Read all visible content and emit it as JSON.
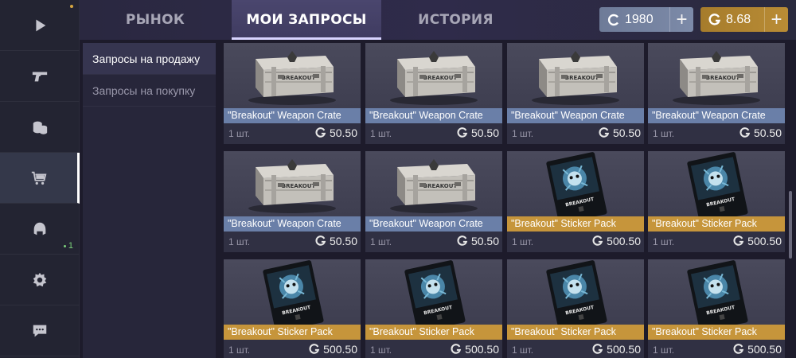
{
  "rail": {
    "badge_count": "1"
  },
  "tabs": [
    {
      "label": "РЫНОК"
    },
    {
      "label": "МОИ ЗАПРОСЫ"
    },
    {
      "label": "ИСТОРИЯ"
    }
  ],
  "currency": {
    "silver": "1980",
    "gold": "8.68",
    "plus": "+"
  },
  "subnav": [
    {
      "label": "Запросы на продажу"
    },
    {
      "label": "Запросы на покупку"
    }
  ],
  "items": [
    {
      "name": "\"Breakout\" Weapon Crate",
      "qty": "1 шт.",
      "price": "50.50",
      "kind": "crate"
    },
    {
      "name": "\"Breakout\" Weapon Crate",
      "qty": "1 шт.",
      "price": "50.50",
      "kind": "crate"
    },
    {
      "name": "\"Breakout\" Weapon Crate",
      "qty": "1 шт.",
      "price": "50.50",
      "kind": "crate"
    },
    {
      "name": "\"Breakout\" Weapon Crate",
      "qty": "1 шт.",
      "price": "50.50",
      "kind": "crate"
    },
    {
      "name": "\"Breakout\" Weapon Crate",
      "qty": "1 шт.",
      "price": "50.50",
      "kind": "crate"
    },
    {
      "name": "\"Breakout\" Weapon Crate",
      "qty": "1 шт.",
      "price": "50.50",
      "kind": "crate"
    },
    {
      "name": "\"Breakout\" Sticker Pack",
      "qty": "1 шт.",
      "price": "500.50",
      "kind": "sticker"
    },
    {
      "name": "\"Breakout\" Sticker Pack",
      "qty": "1 шт.",
      "price": "500.50",
      "kind": "sticker"
    },
    {
      "name": "\"Breakout\" Sticker Pack",
      "qty": "1 шт.",
      "price": "500.50",
      "kind": "sticker"
    },
    {
      "name": "\"Breakout\" Sticker Pack",
      "qty": "1 шт.",
      "price": "500.50",
      "kind": "sticker"
    },
    {
      "name": "\"Breakout\" Sticker Pack",
      "qty": "1 шт.",
      "price": "500.50",
      "kind": "sticker"
    },
    {
      "name": "\"Breakout\" Sticker Pack",
      "qty": "1 шт.",
      "price": "500.50",
      "kind": "sticker"
    }
  ],
  "colors": {
    "crate_label": "#6a7fa8",
    "sticker_label": "#c6953b",
    "gold": "#b98c35",
    "silver": "#7c8aa8"
  }
}
